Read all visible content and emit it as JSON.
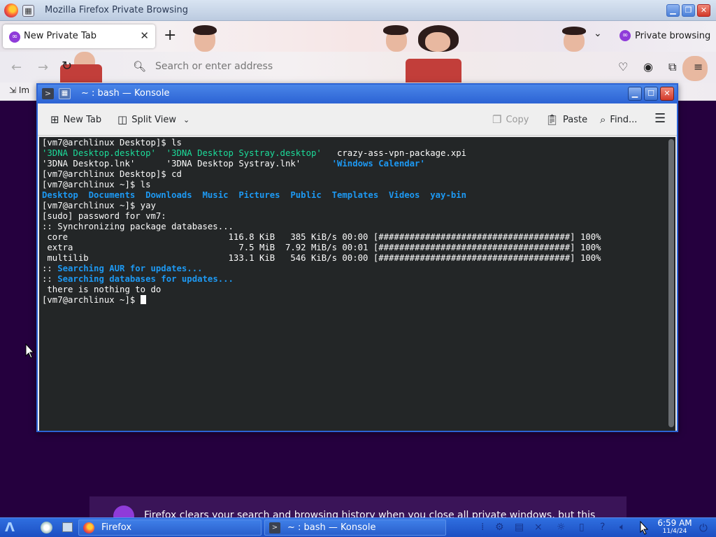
{
  "firefox": {
    "window_title": "Mozilla Firefox Private Browsing",
    "tab_label": "New Private Tab",
    "new_tab_symbol": "+",
    "tab_list_symbol": "⌄",
    "private_indicator": "Private browsing",
    "address_placeholder": "Search or enter address",
    "bookmark_item": "Im",
    "banner_text": "Firefox clears your search and browsing history when you close all private windows, but this"
  },
  "konsole": {
    "window_title": "~ : bash — Konsole",
    "toolbar": {
      "new_tab": "New Tab",
      "split_view": "Split View",
      "copy": "Copy",
      "paste": "Paste",
      "find": "Find..."
    },
    "terminal_lines": [
      [
        {
          "t": "[vm7@archlinux Desktop]$ ls",
          "c": ""
        }
      ],
      [
        {
          "t": "'3DNA Desktop.desktop'  '3DNA Desktop Systray.desktop'",
          "c": "c-green"
        },
        {
          "t": "   crazy-ass-vpn-package.xpi",
          "c": ""
        }
      ],
      [
        {
          "t": "'3DNA Desktop.lnk'      '3DNA Desktop Systray.lnk'      ",
          "c": ""
        },
        {
          "t": "'Windows Calendar'",
          "c": "c-blue"
        }
      ],
      [
        {
          "t": "[vm7@archlinux Desktop]$ cd",
          "c": ""
        }
      ],
      [
        {
          "t": "[vm7@archlinux ~]$ ls",
          "c": ""
        }
      ],
      [
        {
          "t": "Desktop  Documents  Downloads  Music  Pictures  Public  Templates  Videos  yay-bin",
          "c": "c-blue"
        }
      ],
      [
        {
          "t": "[vm7@archlinux ~]$ yay",
          "c": ""
        }
      ],
      [
        {
          "t": "[sudo] password for vm7:",
          "c": ""
        }
      ],
      [
        {
          "t": ":: Synchronizing package databases...",
          "c": ""
        }
      ],
      [
        {
          "t": " core                               116.8 KiB   385 KiB/s 00:00 [#####################################] 100%",
          "c": ""
        }
      ],
      [
        {
          "t": " extra                                7.5 MiB  7.92 MiB/s 00:01 [#####################################] 100%",
          "c": ""
        }
      ],
      [
        {
          "t": " multilib                           133.1 KiB   546 KiB/s 00:00 [#####################################] 100%",
          "c": ""
        }
      ],
      [
        {
          "t": ":: ",
          "c": ""
        },
        {
          "t": "Searching AUR for updates...",
          "c": "c-blue"
        }
      ],
      [
        {
          "t": ":: ",
          "c": ""
        },
        {
          "t": "Searching databases for updates...",
          "c": "c-blue"
        }
      ],
      [
        {
          "t": " there is nothing to do",
          "c": ""
        }
      ],
      [
        {
          "t": "[vm7@archlinux ~]$ ",
          "c": ""
        }
      ]
    ]
  },
  "taskbar": {
    "tasks": [
      "Firefox",
      "~ : bash — Konsole"
    ],
    "time": "6:59 AM",
    "date": "11/4/24"
  },
  "colors": {
    "konsole_border": "#2c63d4",
    "terminal_bg": "#232627",
    "terminal_green": "#1cdc9a",
    "terminal_blue": "#1d99f3",
    "private_purple": "#25003e",
    "taskbar_blue": "#1c4fc2"
  }
}
